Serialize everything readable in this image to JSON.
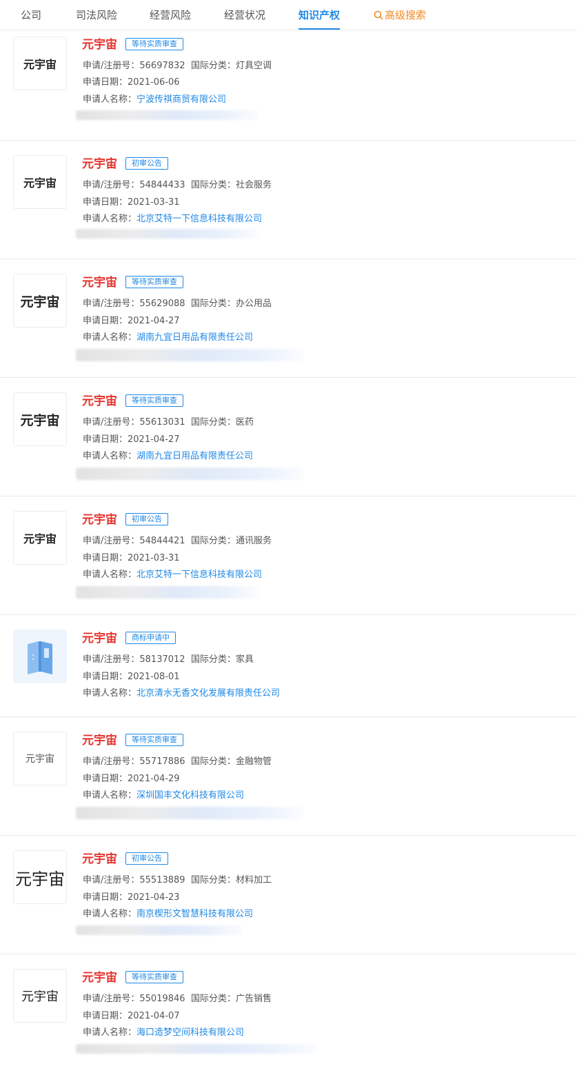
{
  "tabs": [
    {
      "label": "公司"
    },
    {
      "label": "司法风险"
    },
    {
      "label": "经营风险"
    },
    {
      "label": "经营状况"
    },
    {
      "label": "知识产权",
      "active": true
    },
    {
      "label": "高级搜索",
      "icon": "search-icon"
    }
  ],
  "labels": {
    "reg_no": "申请/注册号：",
    "intl_class": "国际分类：",
    "apply_date": "申请日期：",
    "applicant": "申请人名称："
  },
  "colors": {
    "accent": "#1e88e5",
    "name_red": "#e5322d",
    "advanced_orange": "#f08a24"
  },
  "items": [
    {
      "logo_text": "元宇宙",
      "name": "元宇宙",
      "status": "等待实质审查",
      "reg_no": "56697832",
      "intl_class": "灯具空调",
      "apply_date": "2021-06-06",
      "applicant": "宁波传祺商贸有限公司"
    },
    {
      "logo_text": "元宇宙",
      "name": "元宇宙",
      "status": "初审公告",
      "reg_no": "54844433",
      "intl_class": "社会服务",
      "apply_date": "2021-03-31",
      "applicant": "北京艾特一下信息科技有限公司"
    },
    {
      "logo_text": "元宇宙",
      "name": "元宇宙",
      "status": "等待实质审查",
      "reg_no": "55629088",
      "intl_class": "办公用品",
      "apply_date": "2021-04-27",
      "applicant": "湖南九宜日用品有限责任公司"
    },
    {
      "logo_text": "元宇宙",
      "name": "元宇宙",
      "status": "等待实质审查",
      "reg_no": "55613031",
      "intl_class": "医药",
      "apply_date": "2021-04-27",
      "applicant": "湖南九宜日用品有限责任公司"
    },
    {
      "logo_text": "元宇宙",
      "name": "元宇宙",
      "status": "初审公告",
      "reg_no": "54844421",
      "intl_class": "通讯服务",
      "apply_date": "2021-03-31",
      "applicant": "北京艾特一下信息科技有限公司"
    },
    {
      "logo_icon": "book-icon",
      "name": "元宇宙",
      "status": "商标申请中",
      "reg_no": "58137012",
      "intl_class": "家具",
      "apply_date": "2021-08-01",
      "applicant": "北京清水无香文化发展有限责任公司"
    },
    {
      "logo_text": "元宇宙",
      "name": "元宇宙",
      "status": "等待实质审查",
      "reg_no": "55717886",
      "intl_class": "金融物管",
      "apply_date": "2021-04-29",
      "applicant": "深圳国丰文化科技有限公司"
    },
    {
      "logo_text": "元宇宙",
      "name": "元宇宙",
      "status": "初审公告",
      "reg_no": "55513889",
      "intl_class": "材料加工",
      "apply_date": "2021-04-23",
      "applicant": "南京楔形文智慧科技有限公司"
    },
    {
      "logo_text": "元宇宙",
      "name": "元宇宙",
      "status": "等待实质审查",
      "reg_no": "55019846",
      "intl_class": "广告销售",
      "apply_date": "2021-04-07",
      "applicant": "海口造梦空间科技有限公司"
    }
  ]
}
